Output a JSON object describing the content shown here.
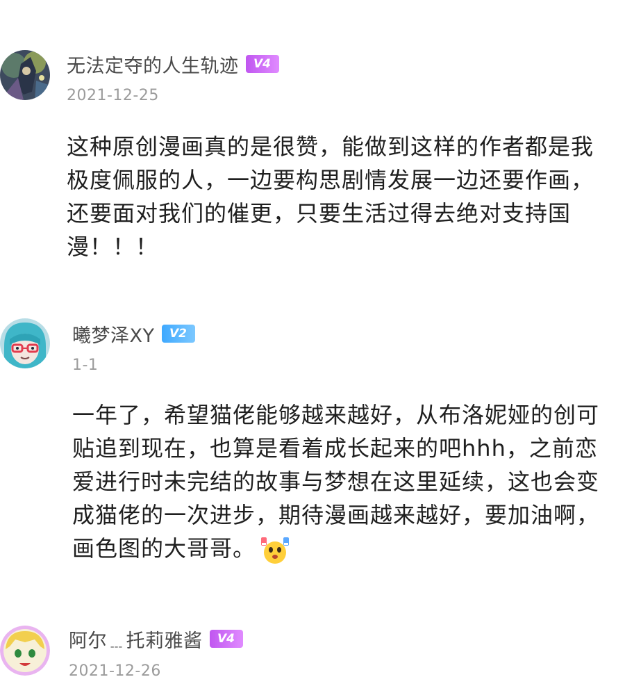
{
  "comments": [
    {
      "username": "无法定夺的人生轨迹",
      "level": "V4",
      "date": "2021-12-25",
      "text": "这种原创漫画真的是很赞，能做到这样的作者都是我\n极度佩服的人，一边要构思剧情发展一边还要作画，\n还要面对我们的催更，只要生活过得去绝对支持国\n漫！！！",
      "badge_color": "#c056f0"
    },
    {
      "username": "曦梦泽XY",
      "level": "V2",
      "date": "1-1",
      "text": "一年了，希望猫佬能够越来越好，从布洛妮娅的创可\n贴追到现在，也算是看着成长起来的吧hhh，之前恋\n爱进行时未完结的故事与梦想在这里延续，这也会变\n成猫佬的一次进步，期待漫画越来越好，要加油啊，\n画色图的大哥哥。",
      "emoji": "cheer-emoji",
      "badge_color": "#3ea9ff"
    },
    {
      "username": "阿尔﹍托莉雅酱",
      "level": "V4",
      "date": "2021-12-26",
      "badge_color": "#c056f0"
    }
  ]
}
